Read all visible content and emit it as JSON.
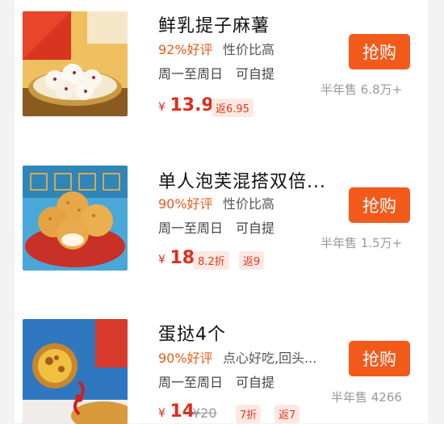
{
  "products": [
    {
      "title": "鲜乳提子麻薯",
      "rating": "92%好评",
      "tag": "性价比高",
      "availability": "周一至周日　可自提",
      "currency": "¥",
      "price": "13.9",
      "rebate": "返6.95",
      "buy_label": "抢购",
      "sold": "半年售 6.8万+"
    },
    {
      "title": "单人泡芙混搭双倍...",
      "rating": "90%好评",
      "tag": "性价比高",
      "availability": "周一至周日　可自提",
      "currency": "¥",
      "price": "18",
      "discount": "8.2折",
      "rebate": "返9",
      "buy_label": "抢购",
      "sold": "半年售 1.5万+"
    },
    {
      "title": "蛋挞4个",
      "rating": "90%好评",
      "tag": "点心好吃,回头...",
      "availability": "周一至周日　可自提",
      "currency": "¥",
      "price": "14",
      "original_price": "¥20",
      "discount": "7折",
      "rebate": "返7",
      "buy_label": "抢购",
      "sold": "半年售 4266"
    }
  ],
  "colors": {
    "accent": "#f25a1c",
    "price": "#e02d1a",
    "rating": "#e85a1c"
  },
  "icons": [
    "product-image-mochi",
    "product-image-puffs",
    "product-image-egg-tarts"
  ]
}
